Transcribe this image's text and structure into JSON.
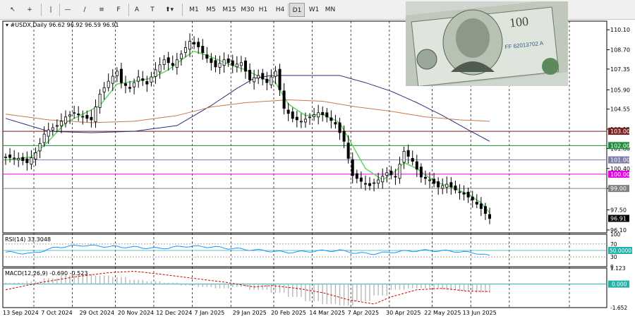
{
  "toolbar": {
    "tools": [
      {
        "icon": "cursor-icon"
      },
      {
        "icon": "crosshair-icon"
      },
      {
        "icon": "vertical-line-icon"
      },
      {
        "icon": "horizontal-line-icon"
      },
      {
        "icon": "trendline-icon"
      },
      {
        "icon": "equidistant-channel-icon"
      },
      {
        "icon": "fibonacci-icon"
      },
      {
        "icon": "text-icon"
      },
      {
        "icon": "text-label-icon"
      },
      {
        "icon": "arrows-shapes-icon"
      }
    ],
    "timeframes": [
      "M1",
      "M5",
      "M15",
      "M30",
      "H1",
      "H4",
      "D1",
      "W1",
      "MN"
    ],
    "active_timeframe": "D1"
  },
  "chart_header": {
    "symbol": "#USDX,Daily",
    "ohlc": "96.62 96.92 96.59 96.91"
  },
  "chart_data": {
    "type": "candlestick",
    "symbol": "#USDX",
    "timeframe": "Daily",
    "x_tick_labels": [
      "13 Sep 2024",
      "7 Oct 2024",
      "29 Oct 2024",
      "20 Nov 2024",
      "12 Dec 2024",
      "7 Jan 2025",
      "29 Jan 2025",
      "20 Feb 2025",
      "14 Mar 2025",
      "7 Apr 2025",
      "30 Apr 2025",
      "22 May 2025",
      "13 Jun 2025"
    ],
    "y_tick_labels": [
      "110.10",
      "108.70",
      "107.35",
      "105.90",
      "104.55",
      "103.15",
      "101.80",
      "100.40",
      "99.00",
      "97.50",
      "96.10"
    ],
    "ylim": [
      95.9,
      110.7
    ],
    "current_price": "96.91",
    "price_path": [
      [
        0,
        101.2
      ],
      [
        3,
        101.1
      ],
      [
        5,
        100.8
      ],
      [
        7,
        101.5
      ],
      [
        9,
        102.8
      ],
      [
        10,
        103.1
      ],
      [
        12,
        103.4
      ],
      [
        14,
        104.0
      ],
      [
        16,
        104.3
      ],
      [
        18,
        104.0
      ],
      [
        20,
        103.8
      ],
      [
        22,
        105.6
      ],
      [
        24,
        106.5
      ],
      [
        26,
        107.2
      ],
      [
        27,
        106.4
      ],
      [
        29,
        106.0
      ],
      [
        31,
        106.8
      ],
      [
        33,
        106.3
      ],
      [
        35,
        107.3
      ],
      [
        37,
        108.0
      ],
      [
        39,
        107.6
      ],
      [
        41,
        108.4
      ],
      [
        43,
        109.3
      ],
      [
        45,
        108.9
      ],
      [
        47,
        108.1
      ],
      [
        49,
        107.5
      ],
      [
        51,
        108.0
      ],
      [
        53,
        107.6
      ],
      [
        55,
        107.8
      ],
      [
        57,
        106.6
      ],
      [
        59,
        106.9
      ],
      [
        61,
        106.4
      ],
      [
        63,
        107.2
      ],
      [
        65,
        104.6
      ],
      [
        67,
        103.9
      ],
      [
        69,
        103.7
      ],
      [
        71,
        104.0
      ],
      [
        73,
        104.3
      ],
      [
        75,
        104.0
      ],
      [
        77,
        103.5
      ],
      [
        79,
        102.3
      ],
      [
        81,
        99.9
      ],
      [
        83,
        99.5
      ],
      [
        85,
        99.2
      ],
      [
        87,
        99.6
      ],
      [
        89,
        100.1
      ],
      [
        91,
        99.8
      ],
      [
        93,
        101.6
      ],
      [
        95,
        100.9
      ],
      [
        97,
        99.8
      ],
      [
        99,
        99.6
      ],
      [
        101,
        99.1
      ],
      [
        103,
        99.3
      ],
      [
        105,
        98.9
      ],
      [
        107,
        98.6
      ],
      [
        109,
        98.2
      ],
      [
        111,
        97.6
      ],
      [
        113,
        96.9
      ]
    ],
    "horizontal_levels": [
      {
        "value": 103.0,
        "label": "103.00",
        "color": "#7a1f1f"
      },
      {
        "value": 102.0,
        "label": "102.00",
        "color": "#1e8c3a"
      },
      {
        "value": 101.0,
        "label": "101.00",
        "color": "#7e7ea8"
      },
      {
        "value": 100.0,
        "label": "100.00",
        "color": "#e600e6"
      },
      {
        "value": 99.0,
        "label": "99.00",
        "color": "#808080"
      }
    ],
    "moving_averages": [
      {
        "color": "#6cd66c",
        "path": [
          [
            0,
            101.0
          ],
          [
            6,
            101.2
          ],
          [
            10,
            102.3
          ],
          [
            14,
            103.6
          ],
          [
            18,
            104.2
          ],
          [
            22,
            104.8
          ],
          [
            26,
            106.3
          ],
          [
            30,
            106.5
          ],
          [
            34,
            106.7
          ],
          [
            38,
            107.3
          ],
          [
            42,
            108.2
          ],
          [
            44,
            108.6
          ],
          [
            48,
            108.2
          ],
          [
            52,
            107.7
          ],
          [
            56,
            107.3
          ],
          [
            60,
            106.7
          ],
          [
            63,
            106.4
          ],
          [
            66,
            104.9
          ],
          [
            70,
            104.1
          ],
          [
            74,
            104.2
          ],
          [
            78,
            103.6
          ],
          [
            81,
            102.0
          ],
          [
            84,
            100.4
          ],
          [
            88,
            99.6
          ],
          [
            91,
            100.2
          ],
          [
            93,
            100.8
          ],
          [
            96,
            100.4
          ],
          [
            100,
            99.5
          ],
          [
            104,
            99.1
          ],
          [
            108,
            98.6
          ],
          [
            111,
            98.0
          ],
          [
            113,
            97.3
          ]
        ]
      },
      {
        "color": "#2e2e7a",
        "path": [
          [
            0,
            103.9
          ],
          [
            10,
            103.0
          ],
          [
            20,
            102.9
          ],
          [
            30,
            103.0
          ],
          [
            40,
            103.4
          ],
          [
            48,
            104.8
          ],
          [
            54,
            106.0
          ],
          [
            58,
            106.7
          ],
          [
            62,
            106.9
          ],
          [
            68,
            106.9
          ],
          [
            72,
            106.9
          ],
          [
            78,
            106.9
          ],
          [
            84,
            106.4
          ],
          [
            90,
            105.8
          ],
          [
            96,
            105.0
          ],
          [
            102,
            104.1
          ],
          [
            108,
            103.1
          ],
          [
            113,
            102.3
          ]
        ]
      },
      {
        "color": "#c87a4a",
        "path": [
          [
            0,
            104.2
          ],
          [
            10,
            103.8
          ],
          [
            20,
            103.6
          ],
          [
            30,
            103.7
          ],
          [
            40,
            104.1
          ],
          [
            48,
            104.7
          ],
          [
            56,
            105.0
          ],
          [
            66,
            105.2
          ],
          [
            74,
            105.1
          ],
          [
            82,
            104.7
          ],
          [
            90,
            104.4
          ],
          [
            98,
            104.0
          ],
          [
            106,
            103.8
          ],
          [
            113,
            103.7
          ]
        ]
      }
    ]
  },
  "rsi": {
    "label": "RSI(14) 33.3048",
    "levels": [
      "100",
      "70",
      "50.0000",
      "30",
      "0"
    ],
    "path": [
      [
        0,
        45
      ],
      [
        6,
        40
      ],
      [
        12,
        60
      ],
      [
        18,
        66
      ],
      [
        24,
        62
      ],
      [
        30,
        60
      ],
      [
        36,
        56
      ],
      [
        42,
        63
      ],
      [
        48,
        61
      ],
      [
        54,
        55
      ],
      [
        60,
        50
      ],
      [
        66,
        44
      ],
      [
        72,
        48
      ],
      [
        78,
        50
      ],
      [
        82,
        42
      ],
      [
        86,
        40
      ],
      [
        92,
        47
      ],
      [
        98,
        50
      ],
      [
        104,
        48
      ],
      [
        110,
        42
      ],
      [
        113,
        33
      ]
    ]
  },
  "macd": {
    "label": "MACD(12,26,9) -0.690 -0.523",
    "levels": [
      "1.123",
      "0.000",
      "-1.652"
    ],
    "signal_path": [
      [
        0,
        -0.4
      ],
      [
        8,
        0.1
      ],
      [
        16,
        0.5
      ],
      [
        24,
        0.8
      ],
      [
        30,
        0.9
      ],
      [
        36,
        0.7
      ],
      [
        44,
        0.4
      ],
      [
        52,
        0.1
      ],
      [
        58,
        -0.2
      ],
      [
        62,
        -0.1
      ],
      [
        68,
        -0.3
      ],
      [
        74,
        -0.6
      ],
      [
        80,
        -1.1
      ],
      [
        86,
        -1.4
      ],
      [
        90,
        -0.9
      ],
      [
        96,
        -0.4
      ],
      [
        102,
        -0.3
      ],
      [
        108,
        -0.5
      ],
      [
        113,
        -0.52
      ]
    ],
    "histogram": [
      0.1,
      0.2,
      0.4,
      0.6,
      0.7,
      0.6,
      0.5,
      0.3,
      0.2,
      0.1,
      -0.1,
      -0.2,
      -0.3,
      -0.2,
      -0.4,
      -0.6,
      -0.9,
      -1.2,
      -1.4,
      -1.5,
      -1.2,
      -0.8,
      -0.4,
      -0.3,
      -0.3,
      -0.4,
      -0.5,
      -0.6
    ]
  },
  "image_overlay": {
    "desc_icon": "dollar-banknote-icon"
  }
}
